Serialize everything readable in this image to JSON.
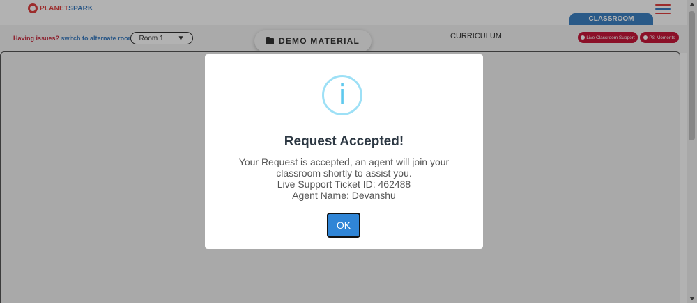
{
  "brand": {
    "name_part1": "PLANET",
    "name_part2": "SPARK"
  },
  "colors": {
    "brand_red": "#e0403f",
    "brand_blue": "#3a7cc1",
    "accent_pill": "#c8173a",
    "ok_button": "#3085d6"
  },
  "toolbar": {
    "issues_text": "Having issues?",
    "switch_link": "switch to alternate room",
    "room_select_value": "Room 1",
    "demo_material_label": "DEMO MATERIAL",
    "curriculum_label": "CURRICULUM",
    "classroom_tab_label": "CLASSROOM",
    "live_support_label": "Live Classroom Support",
    "ps_moments_label": "PS Moments"
  },
  "modal": {
    "icon_glyph": "i",
    "title": "Request Accepted!",
    "body_line1": "Your Request is accepted, an agent will join your classroom shortly to assist you.",
    "ticket_line": "Live Support Ticket ID: 462488",
    "agent_line": "Agent Name: Devanshu",
    "ok_label": "OK"
  }
}
